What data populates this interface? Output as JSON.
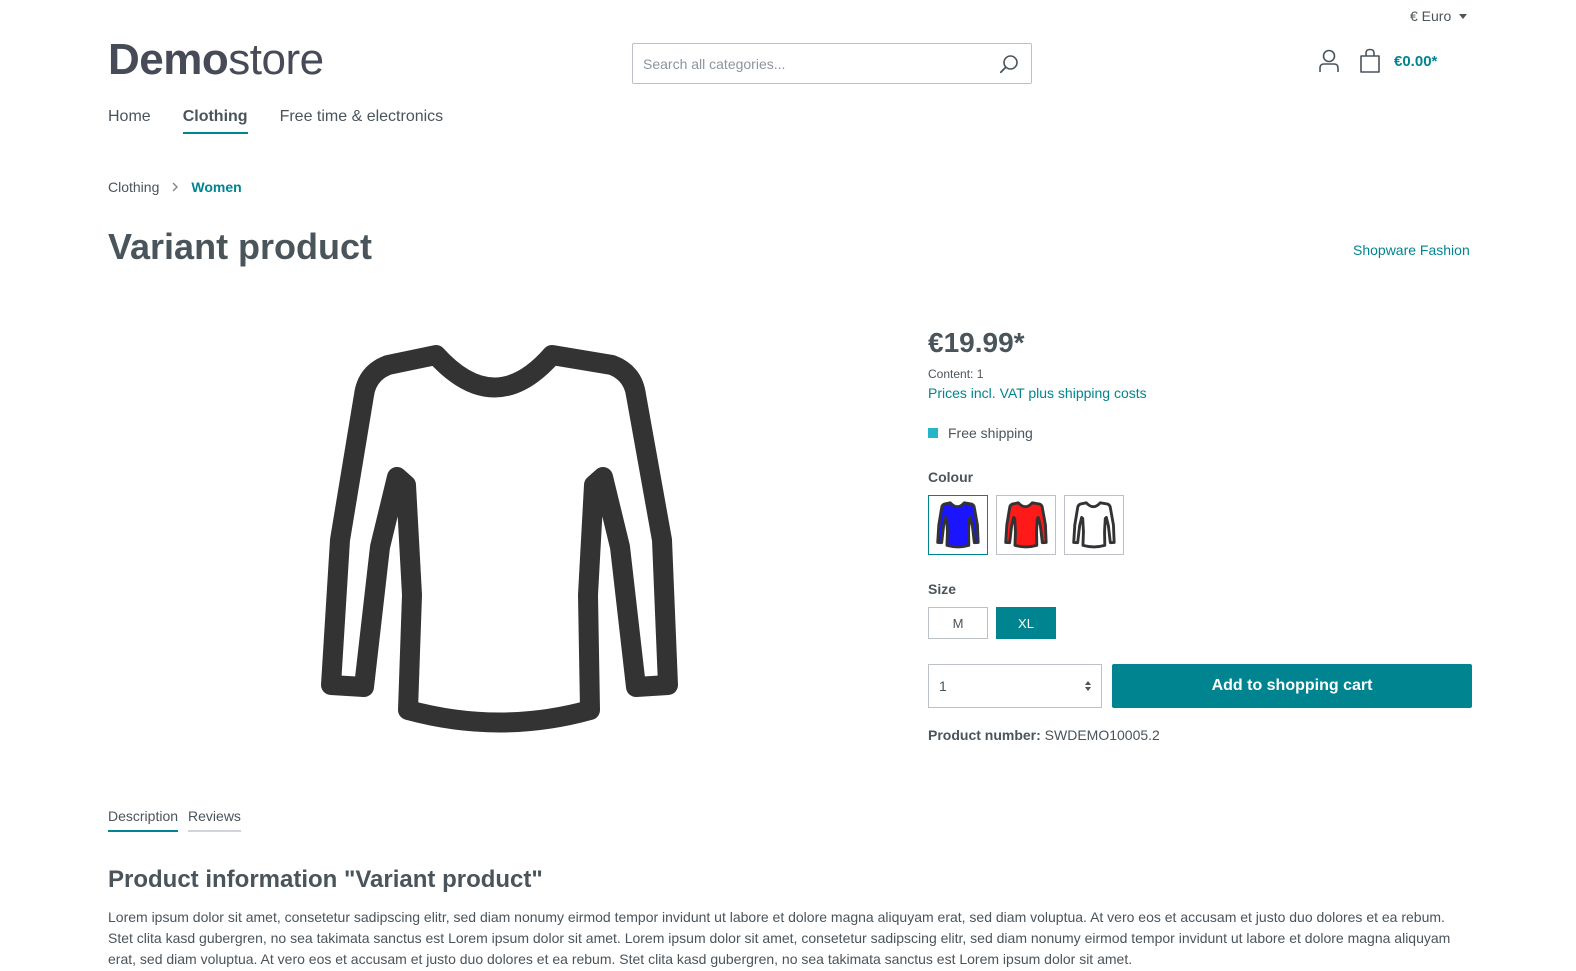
{
  "topbar": {
    "currency_label": "€ Euro"
  },
  "logo": {
    "strong": "Demo",
    "light": "store"
  },
  "search": {
    "placeholder": "Search all categories..."
  },
  "header": {
    "cart_total": "€0.00*"
  },
  "nav": {
    "items": [
      {
        "label": "Home",
        "active": false
      },
      {
        "label": "Clothing",
        "active": true
      },
      {
        "label": "Free time & electronics",
        "active": false
      }
    ]
  },
  "breadcrumb": {
    "items": [
      "Clothing",
      "Women"
    ]
  },
  "product": {
    "title": "Variant product",
    "manufacturer": "Shopware Fashion",
    "price": "€19.99*",
    "content": "Content: 1",
    "tax_link": "Prices incl. VAT plus shipping costs",
    "delivery": "Free shipping",
    "delivery_color": "#26b5c7",
    "colour_label": "Colour",
    "colours": [
      {
        "name": "blue",
        "hex": "#1a14ff",
        "selected": true
      },
      {
        "name": "red",
        "hex": "#ff1a1a",
        "selected": false
      },
      {
        "name": "white",
        "hex": "#ffffff",
        "selected": false
      }
    ],
    "size_label": "Size",
    "sizes": [
      {
        "label": "M",
        "selected": false
      },
      {
        "label": "XL",
        "selected": true
      }
    ],
    "quantity": "1",
    "add_to_cart": "Add to shopping cart",
    "number_label": "Product number:",
    "number_value": "SWDEMO10005.2"
  },
  "tabs": [
    {
      "label": "Description",
      "active": true
    },
    {
      "label": "Reviews",
      "active": false
    }
  ],
  "description": {
    "title": "Product information \"Variant product\"",
    "text": "Lorem ipsum dolor sit amet, consetetur sadipscing elitr, sed diam nonumy eirmod tempor invidunt ut labore et dolore magna aliquyam erat, sed diam voluptua. At vero eos et accusam et justo duo dolores et ea rebum. Stet clita kasd gubergren, no sea takimata sanctus est Lorem ipsum dolor sit amet. Lorem ipsum dolor sit amet, consetetur sadipscing elitr, sed diam nonumy eirmod tempor invidunt ut labore et dolore magna aliquyam erat, sed diam voluptua. At vero eos et accusam et justo duo dolores et ea rebum. Stet clita kasd gubergren, no sea takimata sanctus est Lorem ipsum dolor sit amet."
  },
  "colors": {
    "accent": "#008490",
    "text": "#4a545b",
    "border": "#bcc1c7"
  }
}
